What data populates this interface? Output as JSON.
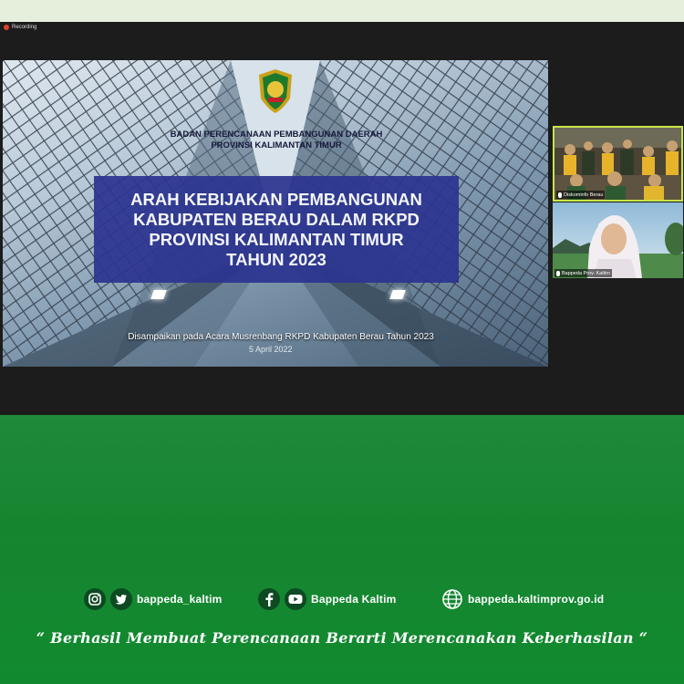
{
  "recording": {
    "label": "Recording"
  },
  "slide": {
    "org_line1": "BADAN PERENCANAAN PEMBANGUNAN DAERAH",
    "org_line2": "PROVINSI KALIMANTAN TIMUR",
    "title_lines": [
      "ARAH KEBIJAKAN PEMBANGUNAN",
      "KABUPATEN BERAU DALAM RKPD",
      "PROVINSI KALIMANTAN TIMUR",
      "TAHUN 2023"
    ],
    "footer": "Disampaikan pada Acara Musrenbang RKPD Kabupaten Berau Tahun 2023",
    "footer_cut": "5 April 2022"
  },
  "participants": [
    {
      "name": "Diskominfo Berau"
    },
    {
      "name": "Bappeda Prov. Kaltim"
    }
  ],
  "social": {
    "instagram_twitter": "bappeda_kaltim",
    "facebook_youtube": "Bappeda Kaltim",
    "website": "bappeda.kaltimprov.go.id"
  },
  "motto": "“ Berhasil  Membuat Perencanaan Berarti Merencanakan Keberhasilan “",
  "colors": {
    "green": "#168530",
    "slide_title_bg": "#2c3590",
    "active_border": "#c8e64a"
  }
}
